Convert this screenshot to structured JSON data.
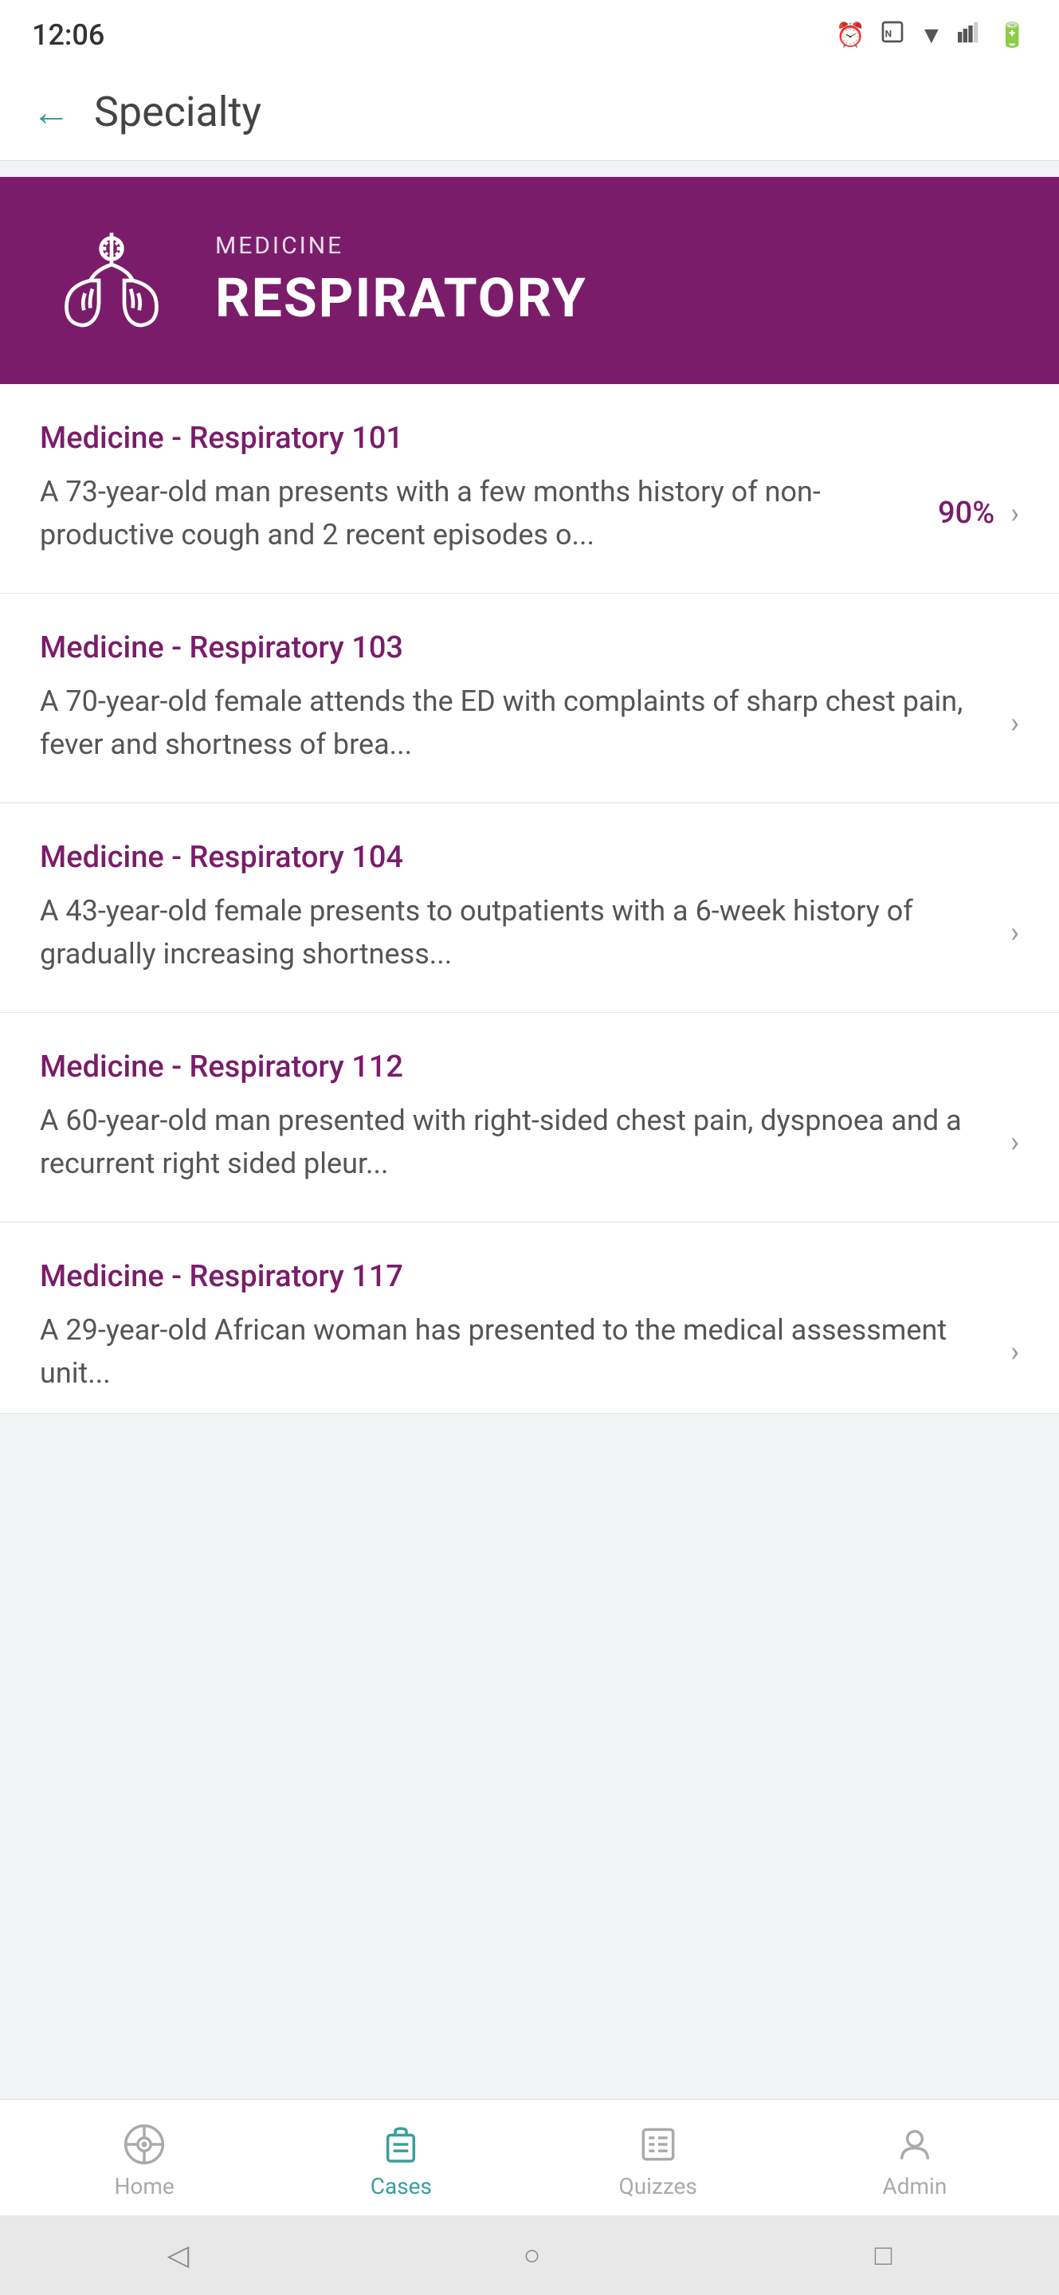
{
  "statusBar": {
    "time": "12:06"
  },
  "header": {
    "backLabel": "←",
    "title": "Specialty"
  },
  "hero": {
    "subtitle": "MEDICINE",
    "title": "RESPIRATORY"
  },
  "cases": [
    {
      "id": "101",
      "title": "Medicine - Respiratory 101",
      "description": "A 73-year-old man presents with a few months history of non-productive cough and 2 recent episodes o...",
      "percent": "90%",
      "hasPercent": true
    },
    {
      "id": "103",
      "title": "Medicine - Respiratory 103",
      "description": "A 70-year-old female attends the ED with complaints of sharp chest pain, fever and shortness of brea...",
      "percent": null,
      "hasPercent": false
    },
    {
      "id": "104",
      "title": "Medicine - Respiratory 104",
      "description": "A 43-year-old female presents to outpatients with a 6-week history of gradually increasing shortness...",
      "percent": null,
      "hasPercent": false
    },
    {
      "id": "112",
      "title": "Medicine - Respiratory 112",
      "description": "A 60-year-old man presented  with right-sided chest pain, dyspnoea and a recurrent right sided pleur...",
      "percent": null,
      "hasPercent": false
    },
    {
      "id": "117",
      "title": "Medicine - Respiratory 117",
      "description": "A 29-year-old African woman has presented to the medical assessment unit...",
      "percent": null,
      "hasPercent": false,
      "truncated": true
    }
  ],
  "bottomNav": {
    "items": [
      {
        "id": "home",
        "label": "Home",
        "active": false
      },
      {
        "id": "cases",
        "label": "Cases",
        "active": true
      },
      {
        "id": "quizzes",
        "label": "Quizzes",
        "active": false
      },
      {
        "id": "admin",
        "label": "Admin",
        "active": false
      }
    ]
  },
  "colors": {
    "purple": "#7b1c6b",
    "teal": "#3a9e9e"
  }
}
